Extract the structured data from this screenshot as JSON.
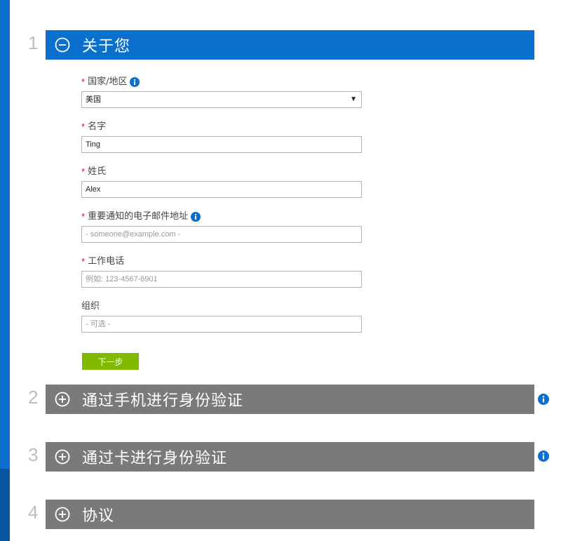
{
  "sections": [
    {
      "num": "1",
      "title": "关于您",
      "state": "expanded"
    },
    {
      "num": "2",
      "title": "通过手机进行身份验证",
      "state": "collapsed"
    },
    {
      "num": "3",
      "title": "通过卡进行身份验证",
      "state": "collapsed"
    },
    {
      "num": "4",
      "title": "协议",
      "state": "collapsed"
    }
  ],
  "form": {
    "country": {
      "required": "*",
      "label": "国家/地区",
      "value": "美国",
      "dropdown_arrow": "▼"
    },
    "first_name": {
      "required": "*",
      "label": "名字",
      "value": "Ting"
    },
    "last_name": {
      "required": "*",
      "label": "姓氏",
      "value": "Alex"
    },
    "email": {
      "required": "*",
      "label": "重要通知的电子邮件地址",
      "placeholder": "- someone@example.com -"
    },
    "phone": {
      "required": "*",
      "label": "工作电话",
      "placeholder": "例如: 123-4567-8901"
    },
    "organization": {
      "label": "组织",
      "placeholder": "- 可选 -"
    }
  },
  "next_button": "下一步",
  "colors": {
    "accent_blue": "#0a6fcd",
    "collapsed_gray": "#7a7a7a",
    "button_green": "#7fba00",
    "required_red": "#e81123"
  },
  "icons": {
    "expanded": "minus-circle-icon",
    "collapsed": "plus-circle-icon",
    "info": "info-circle-icon"
  }
}
